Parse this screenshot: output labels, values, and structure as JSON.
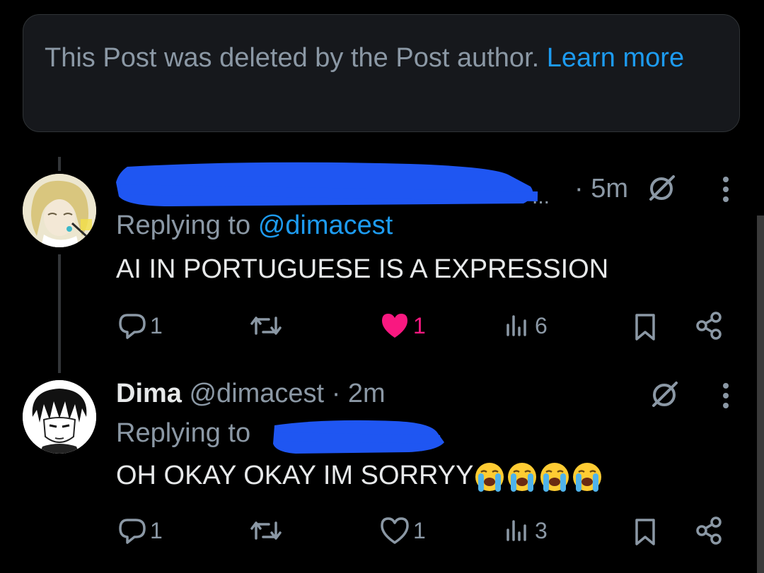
{
  "deleted_notice": {
    "text": "This Post was deleted by the Post author.",
    "link": "Learn more"
  },
  "reply1": {
    "name_ellipsis": "...",
    "time": "· 5m",
    "replying_prefix": "Replying to",
    "replying_handle": "@dimacest",
    "body": "AI IN PORTUGUESE IS A EXPRESSION",
    "stats": {
      "replies": "1",
      "likes": "1",
      "views": "6"
    }
  },
  "reply2": {
    "name": "Dima",
    "handle": "@dimacest",
    "time": "· 2m",
    "replying_prefix": "Replying to",
    "body": "OH OKAY OKAY IM SORRYY",
    "emoji": "loudly-crying-face",
    "emoji_count": 4,
    "stats": {
      "replies": "1",
      "likes": "1",
      "views": "3"
    }
  },
  "colors": {
    "background": "#000000",
    "muted": "#8b98a5",
    "link": "#1d9bf0",
    "like_active": "#f91880",
    "redaction": "#1f56f2"
  },
  "icons": [
    "reply-icon",
    "repost-icon",
    "heart-icon",
    "views-icon",
    "bookmark-icon",
    "share-icon",
    "more-icon",
    "grok-icon"
  ]
}
